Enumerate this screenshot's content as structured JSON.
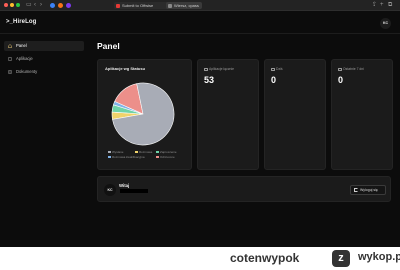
{
  "browser": {
    "tabs": [
      {
        "label": "Submit to Offwise"
      },
      {
        "label": "Wiersz, cpass"
      }
    ]
  },
  "header": {
    "logo": ">_HireLog",
    "avatar_initials": "KC"
  },
  "sidebar": {
    "items": [
      {
        "label": "Panel",
        "icon": "home-icon",
        "active": true
      },
      {
        "label": "Aplikacje",
        "icon": "file-icon",
        "active": false
      },
      {
        "label": "Dokumenty",
        "icon": "document-icon",
        "active": false
      }
    ]
  },
  "main": {
    "title": "Panel",
    "chart_card": {
      "title": "Aplikacje wg Statusu"
    },
    "stats": [
      {
        "label": "Aplikacje łącznie",
        "value": "53",
        "icon": "file-icon"
      },
      {
        "label": "Dziś",
        "value": "0",
        "icon": "calendar-icon"
      },
      {
        "label": "Ostatnie 7 dni",
        "value": "0",
        "icon": "trend-icon"
      }
    ],
    "user_card": {
      "avatar_initials": "KC",
      "welcome": "Witaj",
      "logout_label": "Wyloguj się"
    }
  },
  "chart_data": {
    "type": "pie",
    "title": "Aplikacje wg Statusu",
    "legend_position": "bottom",
    "series": [
      {
        "name": "Wysłane",
        "value": 40,
        "color": "#a8acb6"
      },
      {
        "name": "Rozmowa",
        "value": 2,
        "color": "#f0d36b"
      },
      {
        "name": "Zaproszenie",
        "value": 2,
        "color": "#6ed3a8"
      },
      {
        "name": "Rozmowa kwalifikacyjna",
        "value": 1,
        "color": "#7fb2e8"
      },
      {
        "name": "Odrzucone",
        "value": 8,
        "color": "#ec8f8a"
      }
    ]
  },
  "watermark": {
    "user": "cotenwypok",
    "brand": "wykop.pl",
    "logo": "z"
  },
  "colors": {
    "background": "#0c0c0c",
    "card": "#1b1b1b",
    "text": "#ffffff",
    "muted": "#9a9a9a"
  }
}
